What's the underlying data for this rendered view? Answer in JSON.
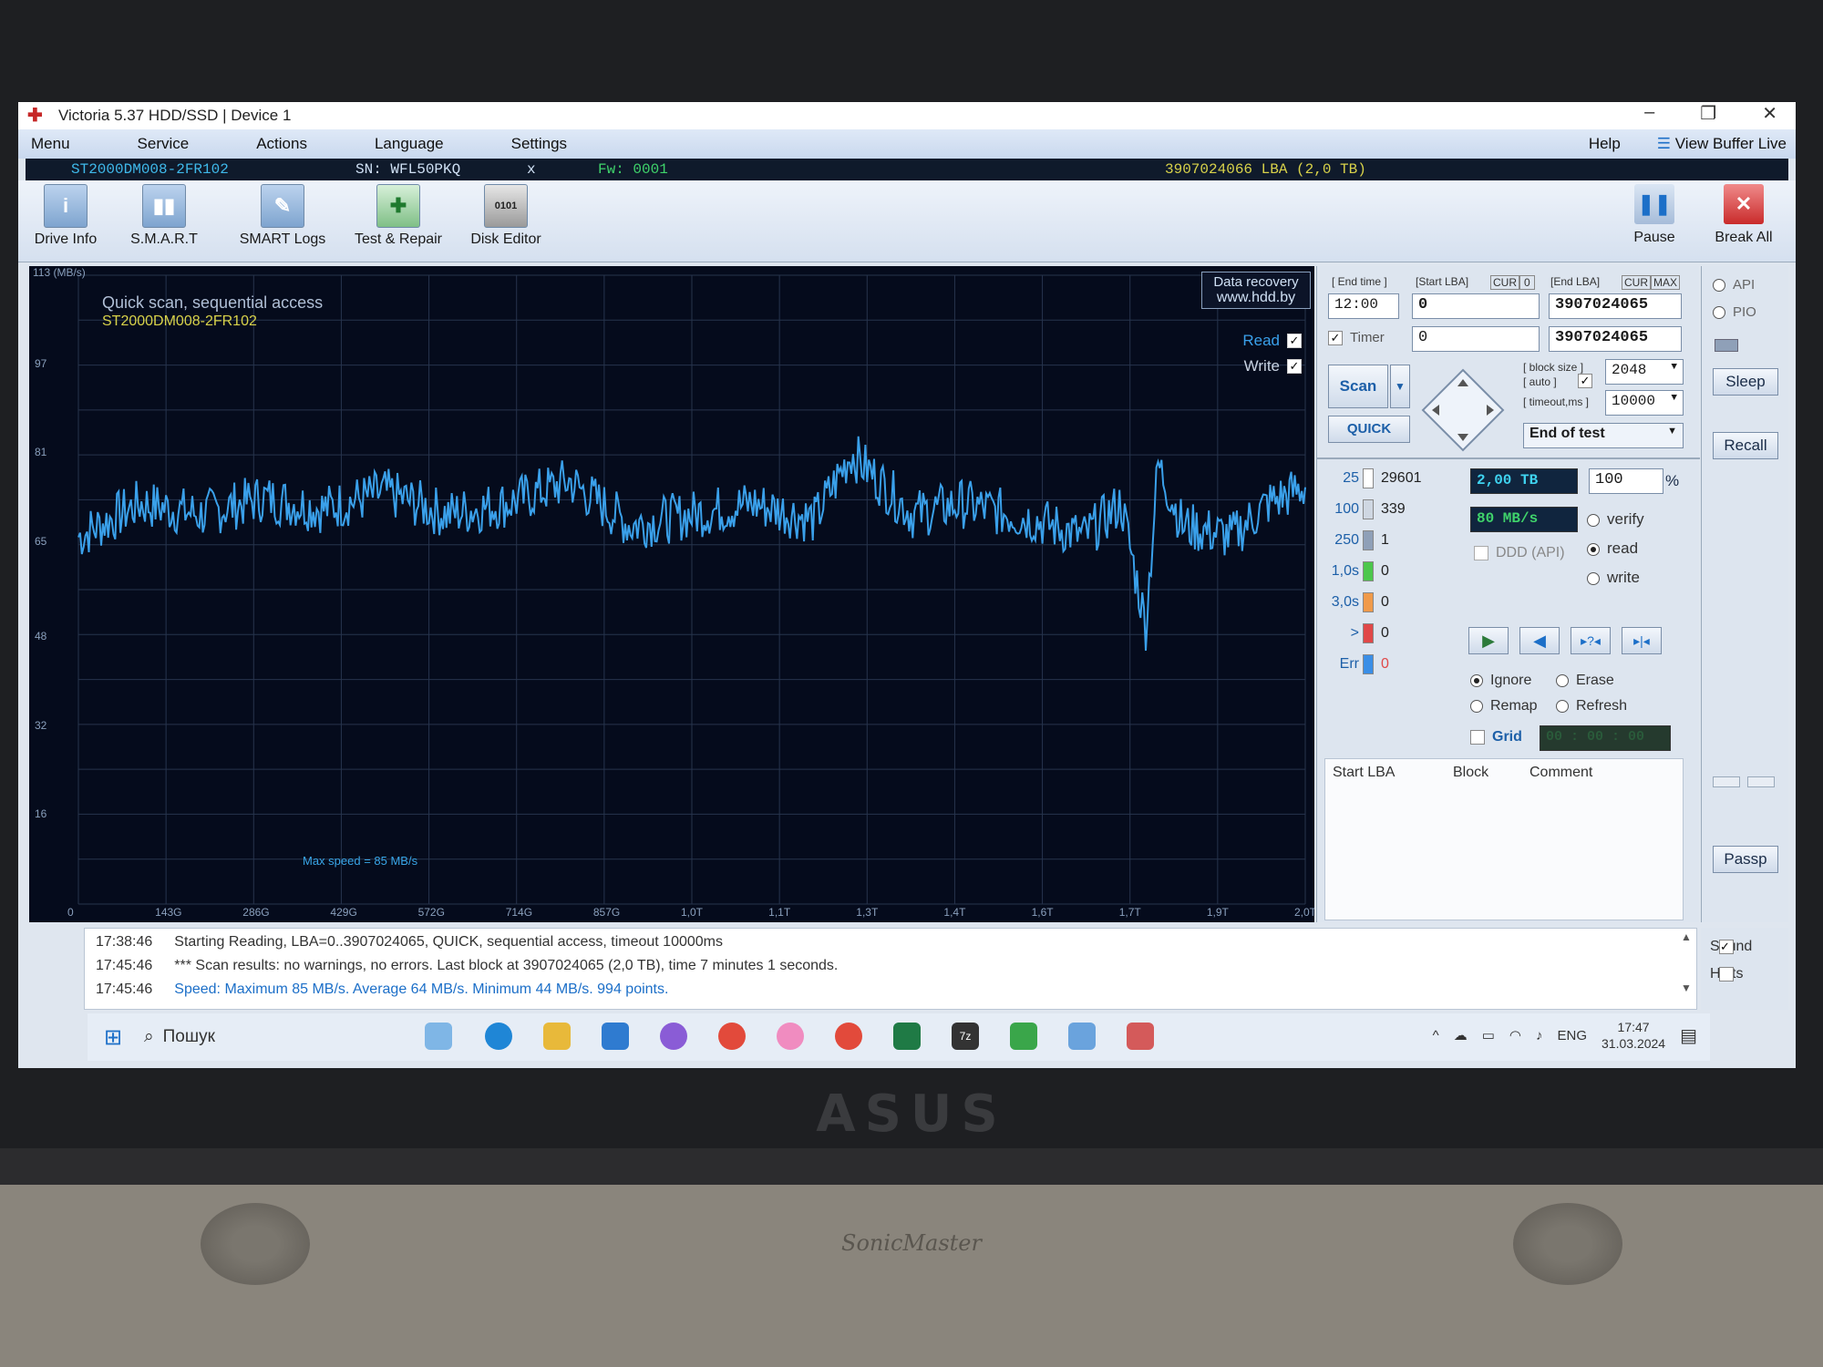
{
  "window": {
    "title": "Victoria 5.37 HDD/SSD | Device 1",
    "controls": [
      "–",
      "❐",
      "✕"
    ]
  },
  "menu": {
    "items": [
      "Menu",
      "Service",
      "Actions",
      "Language",
      "Settings"
    ],
    "help": "Help",
    "view_buffer": "View Buffer Live"
  },
  "device": {
    "model": "ST2000DM008-2FR102",
    "serial": "SN: WFL50PKQ",
    "close": "x",
    "firmware": "Fw: 0001",
    "capacity": "3907024066 LBA (2,0 TB)"
  },
  "toolbar": {
    "buttons": [
      "Drive Info",
      "S.M.A.R.T",
      "SMART Logs",
      "Test & Repair",
      "Disk Editor"
    ],
    "pause": "Pause",
    "break_all": "Break All"
  },
  "graph": {
    "unit": "113 (MB/s)",
    "title": "Quick scan, sequential access",
    "model": "ST2000DM008-2FR102",
    "data_recovery": "Data recovery",
    "data_recovery_url": "www.hdd.by",
    "read_label": "Read",
    "write_label": "Write",
    "max_speed": "Max speed = 85 MB/s",
    "y_ticks": [
      "97",
      "81",
      "65",
      "48",
      "32",
      "16"
    ],
    "x_ticks": [
      "0",
      "143G",
      "286G",
      "429G",
      "572G",
      "714G",
      "857G",
      "1,0T",
      "1,1T",
      "1,3T",
      "1,4T",
      "1,6T",
      "1,7T",
      "1,9T",
      "2,0T"
    ]
  },
  "chart_data": {
    "type": "line",
    "title": "Quick scan, sequential access",
    "xlabel": "",
    "ylabel": "",
    "ylim": [
      0,
      113
    ],
    "x_ticks": [
      "0",
      "143G",
      "286G",
      "429G",
      "572G",
      "714G",
      "857G",
      "1,0T",
      "1,1T",
      "1,3T",
      "1,4T",
      "1,6T",
      "1,7T",
      "1,9T",
      "2,0T"
    ],
    "y_ticks": [
      97,
      81,
      65,
      48,
      32,
      16
    ],
    "series": [
      {
        "x": [
          0,
          0.05,
          0.1,
          0.15,
          0.2,
          0.25,
          0.3,
          0.35,
          0.4,
          0.45,
          0.5,
          0.55,
          0.6,
          0.63,
          0.68,
          0.72,
          0.78,
          0.82,
          0.85,
          0.87,
          0.88,
          0.9,
          0.94,
          0.97,
          1.0
        ],
        "values": [
          66,
          72,
          70,
          73,
          71,
          74,
          70,
          72,
          76,
          68,
          70,
          72,
          69,
          81,
          70,
          72,
          69,
          66,
          72,
          50,
          79,
          68,
          66,
          72,
          75
        ]
      }
    ]
  },
  "panel": {
    "end_time_label": "[ End time ]",
    "end_time": "12:00",
    "start_lba_label": "[Start LBA]",
    "cur": "CUR",
    "zero": "0",
    "end_lba_label": "[End LBA]",
    "cur2": "CUR",
    "max": "MAX",
    "start_lba": "0",
    "end_lba": "3907024065",
    "timer_label": "Timer",
    "timer_value": "0",
    "end_lba_2": "3907024065",
    "block_size_label": "[ block size ]",
    "auto_label": "[ auto ]",
    "timeout_label": "[ timeout,ms ]",
    "block_size": "2048",
    "timeout": "10000",
    "scan": "Scan",
    "quick": "QUICK",
    "end_of_test": "End of test",
    "tb_value": "2,00 TB",
    "percent": "100",
    "percent_sign": "%",
    "speed": "80 MB/s",
    "ddd": "DDD (API)",
    "verify": "verify",
    "read": "read",
    "write": "write",
    "ignore": "Ignore",
    "erase": "Erase",
    "remap": "Remap",
    "refresh": "Refresh",
    "grid": "Grid",
    "grid_time": "00 : 00 : 00",
    "stats": [
      {
        "label": "25",
        "count": "29601",
        "color": "#ffffff"
      },
      {
        "label": "100",
        "count": "339",
        "color": "#cfd7e2"
      },
      {
        "label": "250",
        "count": "1",
        "color": "#8fa0b8"
      },
      {
        "label": "1,0s",
        "count": "0",
        "color": "#4cc74c"
      },
      {
        "label": "3,0s",
        "count": "0",
        "color": "#f09a4a"
      },
      {
        "label": ">",
        "count": "0",
        "color": "#e04848"
      },
      {
        "label": "Err",
        "count": "0",
        "color": "#3a8ee6"
      }
    ],
    "log_cols": [
      "Start LBA",
      "Block",
      "Comment"
    ]
  },
  "far": {
    "api": "API",
    "pio": "PIO",
    "sleep": "Sleep",
    "recall": "Recall",
    "passp": "Passp"
  },
  "log": [
    {
      "time": "17:38:46",
      "text": "Starting Reading, LBA=0..3907024065, QUICK, sequential access, timeout 10000ms"
    },
    {
      "time": "17:45:46",
      "text": "*** Scan results: no warnings, no errors. Last block at 3907024065 (2,0 TB), time 7 minutes 1 seconds."
    },
    {
      "time": "17:45:46",
      "text": "Speed: Maximum 85 MB/s. Average 64 MB/s. Minimum 44 MB/s. 994 points."
    }
  ],
  "log_side": {
    "sound": "Sound",
    "hints": "Hints"
  },
  "taskbar": {
    "search": "Пошук",
    "lang": "ENG",
    "time": "17:47",
    "date": "31.03.2024"
  },
  "laptop": {
    "brand": "ASUS",
    "speaker": "SonicMaster"
  },
  "colors": {
    "graph_bg": "#050b1c",
    "line": "#3aa0ea",
    "grid": "#27344d"
  }
}
